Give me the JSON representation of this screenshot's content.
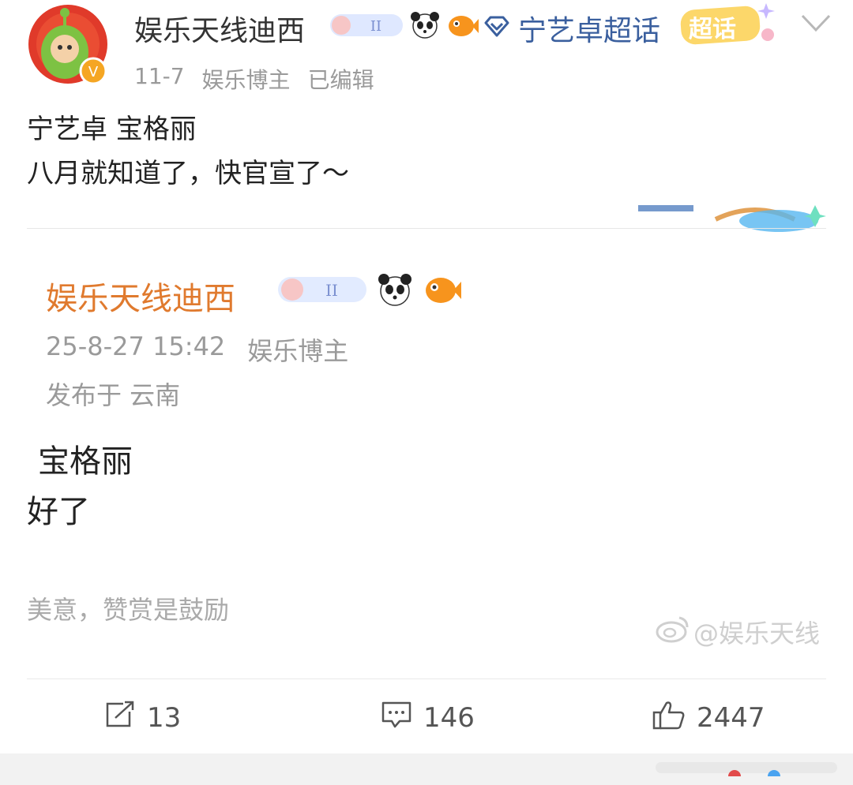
{
  "post": {
    "author": "娱乐天线迪西",
    "supertopic": "宁艺卓超话",
    "supertopic_badge": "超话",
    "date": "11-7",
    "role": "娱乐博主",
    "edited": "已编辑",
    "text_line1": "宁艺卓 宝格丽",
    "text_line2": "八月就知道了，快官宣了～"
  },
  "quoted": {
    "author": "娱乐天线迪西",
    "datetime": "25-8-27 15:42",
    "role": "娱乐博主",
    "location": "发布于 云南",
    "text_line1": "宝格丽",
    "text_line2": "好了",
    "reward": "美意，赞赏是鼓励",
    "watermark": "@娱乐天线"
  },
  "actions": {
    "reposts": "13",
    "comments": "146",
    "likes": "2447"
  },
  "colors": {
    "author_orange": "#e07a2e",
    "supertopic_blue": "#3a5f9e",
    "meta_gray": "#9a9a9a"
  },
  "icons": [
    "avatar",
    "verified-badge-icon",
    "constellation-badge-icon",
    "panda-icon",
    "pufferfish-icon",
    "diamond-icon",
    "chevron-down-icon",
    "repost-icon",
    "comment-icon",
    "like-icon",
    "weibo-logo-icon"
  ]
}
